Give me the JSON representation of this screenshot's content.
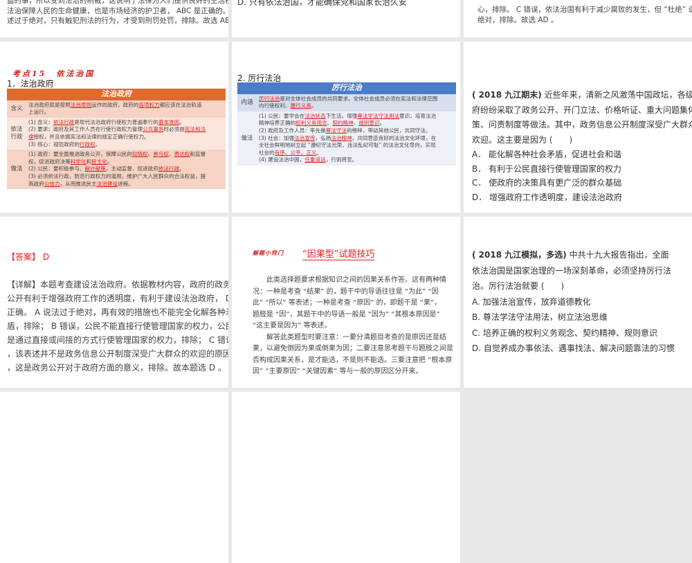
{
  "row1": {
    "left_lines": [
      "益的事，所以受到法治的制裁，这说明了法律为人们提供良好的生活秩序，",
      "法治保障人民的生命健康，也是市场经济的护卫者， ABC 是正确的。 D 表",
      "述过于绝对，只有触犯刑法的行为，才受到刑罚处罚，排除。故选 ABC 。"
    ],
    "middle_line": "D. 只有依法治国，才能确保党和国家长治久安",
    "right_lines": [
      "心，排除。 C 错误，依法治国有利于减少腐败的发生，但 “杜绝” 说法过于",
      "绝对，排除。故选 AD 。"
    ]
  },
  "slide_rule_gov": {
    "kaodian": "考点15　依法治国",
    "heading": "1．法治政府",
    "table_title": "法治政府",
    "rows": [
      {
        "label": "含义",
        "lines": [
          [
            {
              "t": "法治政府就是按照"
            },
            {
              "t": "法治原则",
              "hl": 1
            },
            {
              "t": "运作的政府，政府的"
            },
            {
              "t": "各项权力",
              "hl": 1
            },
            {
              "t": "都应该在法治轨道"
            }
          ],
          [
            {
              "t": "上运行。"
            }
          ]
        ]
      },
      {
        "label": "依法行政",
        "lines": [
          [
            {
              "t": "(1) 含义："
            },
            {
              "t": "依法行政",
              "hl": 1
            },
            {
              "t": "是现代法治政府行使权力普遍奉行的"
            },
            {
              "t": "基本准则",
              "hl": 1
            },
            {
              "t": "。"
            }
          ],
          [
            {
              "t": "(2) 要求：政府及其工作人员在行使行政权力管理"
            },
            {
              "t": "公共事务",
              "hl": 1
            },
            {
              "t": "时必须由"
            },
            {
              "t": "宪法和法",
              "hl": 1
            }
          ],
          [
            {
              "t": "律",
              "hl": 1
            },
            {
              "t": "授权，并且依据宪法和法律的规定正确行使权力。"
            }
          ],
          [
            {
              "t": "(3) 核心：规范政府的"
            },
            {
              "t": "行政权",
              "hl": 1
            },
            {
              "t": "。"
            }
          ]
        ]
      },
      {
        "label": "做法",
        "lines": [
          [
            {
              "t": "(1) 政府：要全面推进政务公开，保障公民的"
            },
            {
              "t": "知情权",
              "hl": 1
            },
            {
              "t": "、"
            },
            {
              "t": "参与权",
              "hl": 1
            },
            {
              "t": "、"
            },
            {
              "t": "表达权",
              "hl": 1
            },
            {
              "t": "和监督"
            }
          ],
          [
            {
              "t": "权，促进政府决策"
            },
            {
              "t": "科学化",
              "hl": 1
            },
            {
              "t": "和"
            },
            {
              "t": "民主化",
              "hl": 1
            },
            {
              "t": "。"
            }
          ],
          [
            {
              "t": "(2) 公民：要积极参与、"
            },
            {
              "t": "献计献策",
              "hl": 1
            },
            {
              "t": "，主动监督，促进政府"
            },
            {
              "t": "依法行政",
              "hl": 1
            },
            {
              "t": "。"
            }
          ],
          [
            {
              "t": "(3) 必须依法行政，防范行政权力的滥用，维护广大人民群众的合法权益，提"
            }
          ],
          [
            {
              "t": "高政府"
            },
            {
              "t": "公信力",
              "hl": 1
            },
            {
              "t": "，从而推进民主"
            },
            {
              "t": "法治建设",
              "hl": 1
            },
            {
              "t": "进程。"
            }
          ]
        ]
      }
    ]
  },
  "slide_rule_law": {
    "heading": "2. 厉行法治",
    "table_title": "厉行法治",
    "rows": [
      {
        "label": "内涵",
        "lines": [
          [
            {
              "t": "厉行法治",
              "hl": 1
            },
            {
              "t": "是对全体社会成员的共同要求。全体社会成员必须在宪法和法律范围"
            }
          ],
          [
            {
              "t": "内行使权利、"
            },
            {
              "t": "履行义务",
              "hl": 1
            },
            {
              "t": "。"
            }
          ]
        ]
      },
      {
        "label": "做法",
        "lines": [
          [
            {
              "t": "(1) 公民：要学会在"
            },
            {
              "t": "法治状态",
              "hl": 1
            },
            {
              "t": "下生活，增强"
            },
            {
              "t": "尊法学法守法用法",
              "hl": 1
            },
            {
              "t": "意识，培育法治"
            }
          ],
          [
            {
              "t": "精神培养正确的"
            },
            {
              "t": "权利义务观念",
              "hl": 1
            },
            {
              "t": "、"
            },
            {
              "t": "契约精神",
              "hl": 1
            },
            {
              "t": "、"
            },
            {
              "t": "规则意识",
              "hl": 1
            },
            {
              "t": "。"
            }
          ],
          [
            {
              "t": "(2) 政府及工作人员：率先做"
            },
            {
              "t": "尊法守法",
              "hl": 1
            },
            {
              "t": "的榜样，带动其他公民，共同守法。"
            }
          ],
          [
            {
              "t": "(3) 社会：加强"
            },
            {
              "t": "法治宣传",
              "hl": 1
            },
            {
              "t": "，弘扬"
            },
            {
              "t": "法治精神",
              "hl": 1
            },
            {
              "t": "，共同营造良好的法治文化环境，在"
            }
          ],
          [
            {
              "t": "全社会鲜明地树立起 “遵纪守法光荣、违法乱纪可耻” 的法治文化导向，实现"
            }
          ],
          [
            {
              "t": "社会的"
            },
            {
              "t": "有序、公平、正义",
              "hl": 1
            },
            {
              "t": "。"
            }
          ],
          [
            {
              "t": "(4) 建设法治中国，"
            },
            {
              "t": "任重道远",
              "hl": 1
            },
            {
              "t": "，行则将至。"
            }
          ]
        ]
      }
    ]
  },
  "question1": {
    "source": "( 2018 九江期末)",
    "lines": [
      "近些年来，清新之风激荡中国政坛，各级政",
      "府纷纷采取了政务公开、开门立法、价格听证、重大问题集体决",
      "策、问责制度等做法。其中，政务信息公开制度深受广大群众的",
      "欢迎。这主要是因为 (　　)"
    ],
    "options": [
      "A．  能化解各种社会矛盾，促进社会和谐",
      "B．  有利于公民直接行使管理国家的权力",
      "C．  使政府的决策具有更广泛的群众基础",
      "D．  增强政府工作透明度，建设法治政府"
    ]
  },
  "answer1": {
    "label": "【答案】",
    "value": "D",
    "lines": [
      "【详解】本题考查建设法治政府。依据教材内容，政府的政务",
      "公开有利于增强政府工作的透明度，有利于建设法治政府， D",
      "正确。 A 说法过于绝对，再有效的措施也不能完全化解各种矛",
      "盾，排除； B 错误，公民不能直接行使管理国家的权力，公民",
      "是通过直接或间接的方式行使管理国家的权力，排除； C 错误",
      "，该表述并不是政务信息公开制度深受广大群众的欢迎的原因",
      "，这是政务公开对于政府方面的意义，排除。故本题选 D 。"
    ]
  },
  "tips": {
    "tag": "解题小窍门",
    "title": "“因果型”试题技巧",
    "lines": [
      "　　此类选择题要求根据知识之间的因果关系作答。这有两种情",
      "况：一种是考查 “结果” 的，题干中的导语往往是 “为此”  “因",
      "此” “所以” 等表述；一种是考查 “原因” 的，即题干是 “果”，",
      "题肢是 “因”，其题干中的导语一般是 “因为”  “其根本原因是”",
      " “这主要是因为” 等表述。",
      "　　解答此类题型时要注意：一要分清题目考查的是原因还是结",
      "果，以避免倒因为果或倒果为因；二要注意思考题干与题肢之间是",
      "否构成因果关系，是才能选，不是则不能选。三要注意把 “根本原",
      "因” “主要原因” “关键因素” 等与一般的原因区分开来。"
    ]
  },
  "question2": {
    "source": "( 2018 九江模拟，多选)",
    "lines": [
      "中共十九大报告指出，全面",
      "依法治国是国家治理的一场深刻革命，必须坚持厉行法",
      "治。厉行法治就要 (　　)"
    ],
    "options": [
      "A. 加强法治宣传，放弃道德教化",
      "B. 尊法学法守法用法，树立法治思维",
      "C. 培养正确的权利义务观念、契约精神、规则意识",
      "D. 自觉养成办事依法、遇事找法、解决问题靠法的习惯"
    ]
  },
  "colors": {
    "orange": "#e0692c",
    "blue": "#4a7cc8",
    "red": "#e02020",
    "gap": "#e8e8e8"
  }
}
